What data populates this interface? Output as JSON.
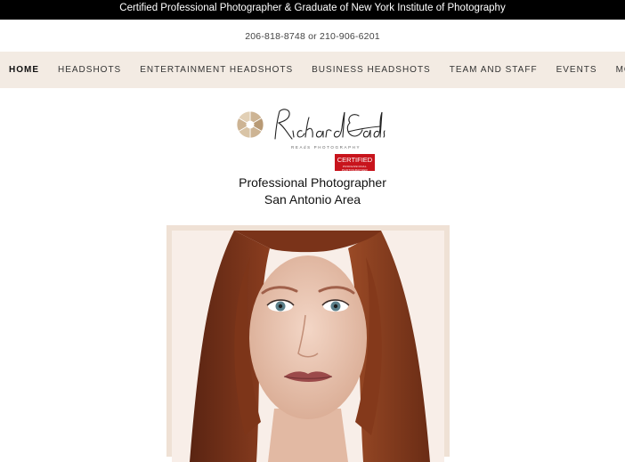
{
  "topbar": {
    "text": "Certified Professional Photographer & Graduate of New York Institute of Photography"
  },
  "phone": {
    "text": "206-818-8748 or 210-906-6201"
  },
  "nav": {
    "items": [
      {
        "label": "HOME",
        "active": true
      },
      {
        "label": "HEADSHOTS"
      },
      {
        "label": "ENTERTAINMENT HEADSHOTS"
      },
      {
        "label": "BUSINESS HEADSHOTS"
      },
      {
        "label": "TEAM AND STAFF"
      },
      {
        "label": "EVENTS"
      }
    ],
    "more_label": "MORE"
  },
  "logo": {
    "signature": "Richard Eads",
    "subtitle": "REAdS PHOTOGRAPHY",
    "badge_main": "CERTIFIED",
    "badge_small": "PROFESSIONAL PHOTOGRAPHER"
  },
  "tagline": {
    "line1": "Professional Photographer",
    "line2": "San Antonio Area"
  },
  "colors": {
    "topbar_bg": "#000000",
    "nav_bg": "#f3ebe3",
    "badge_red": "#c8141c",
    "photo_frame": "#efe1d5"
  }
}
